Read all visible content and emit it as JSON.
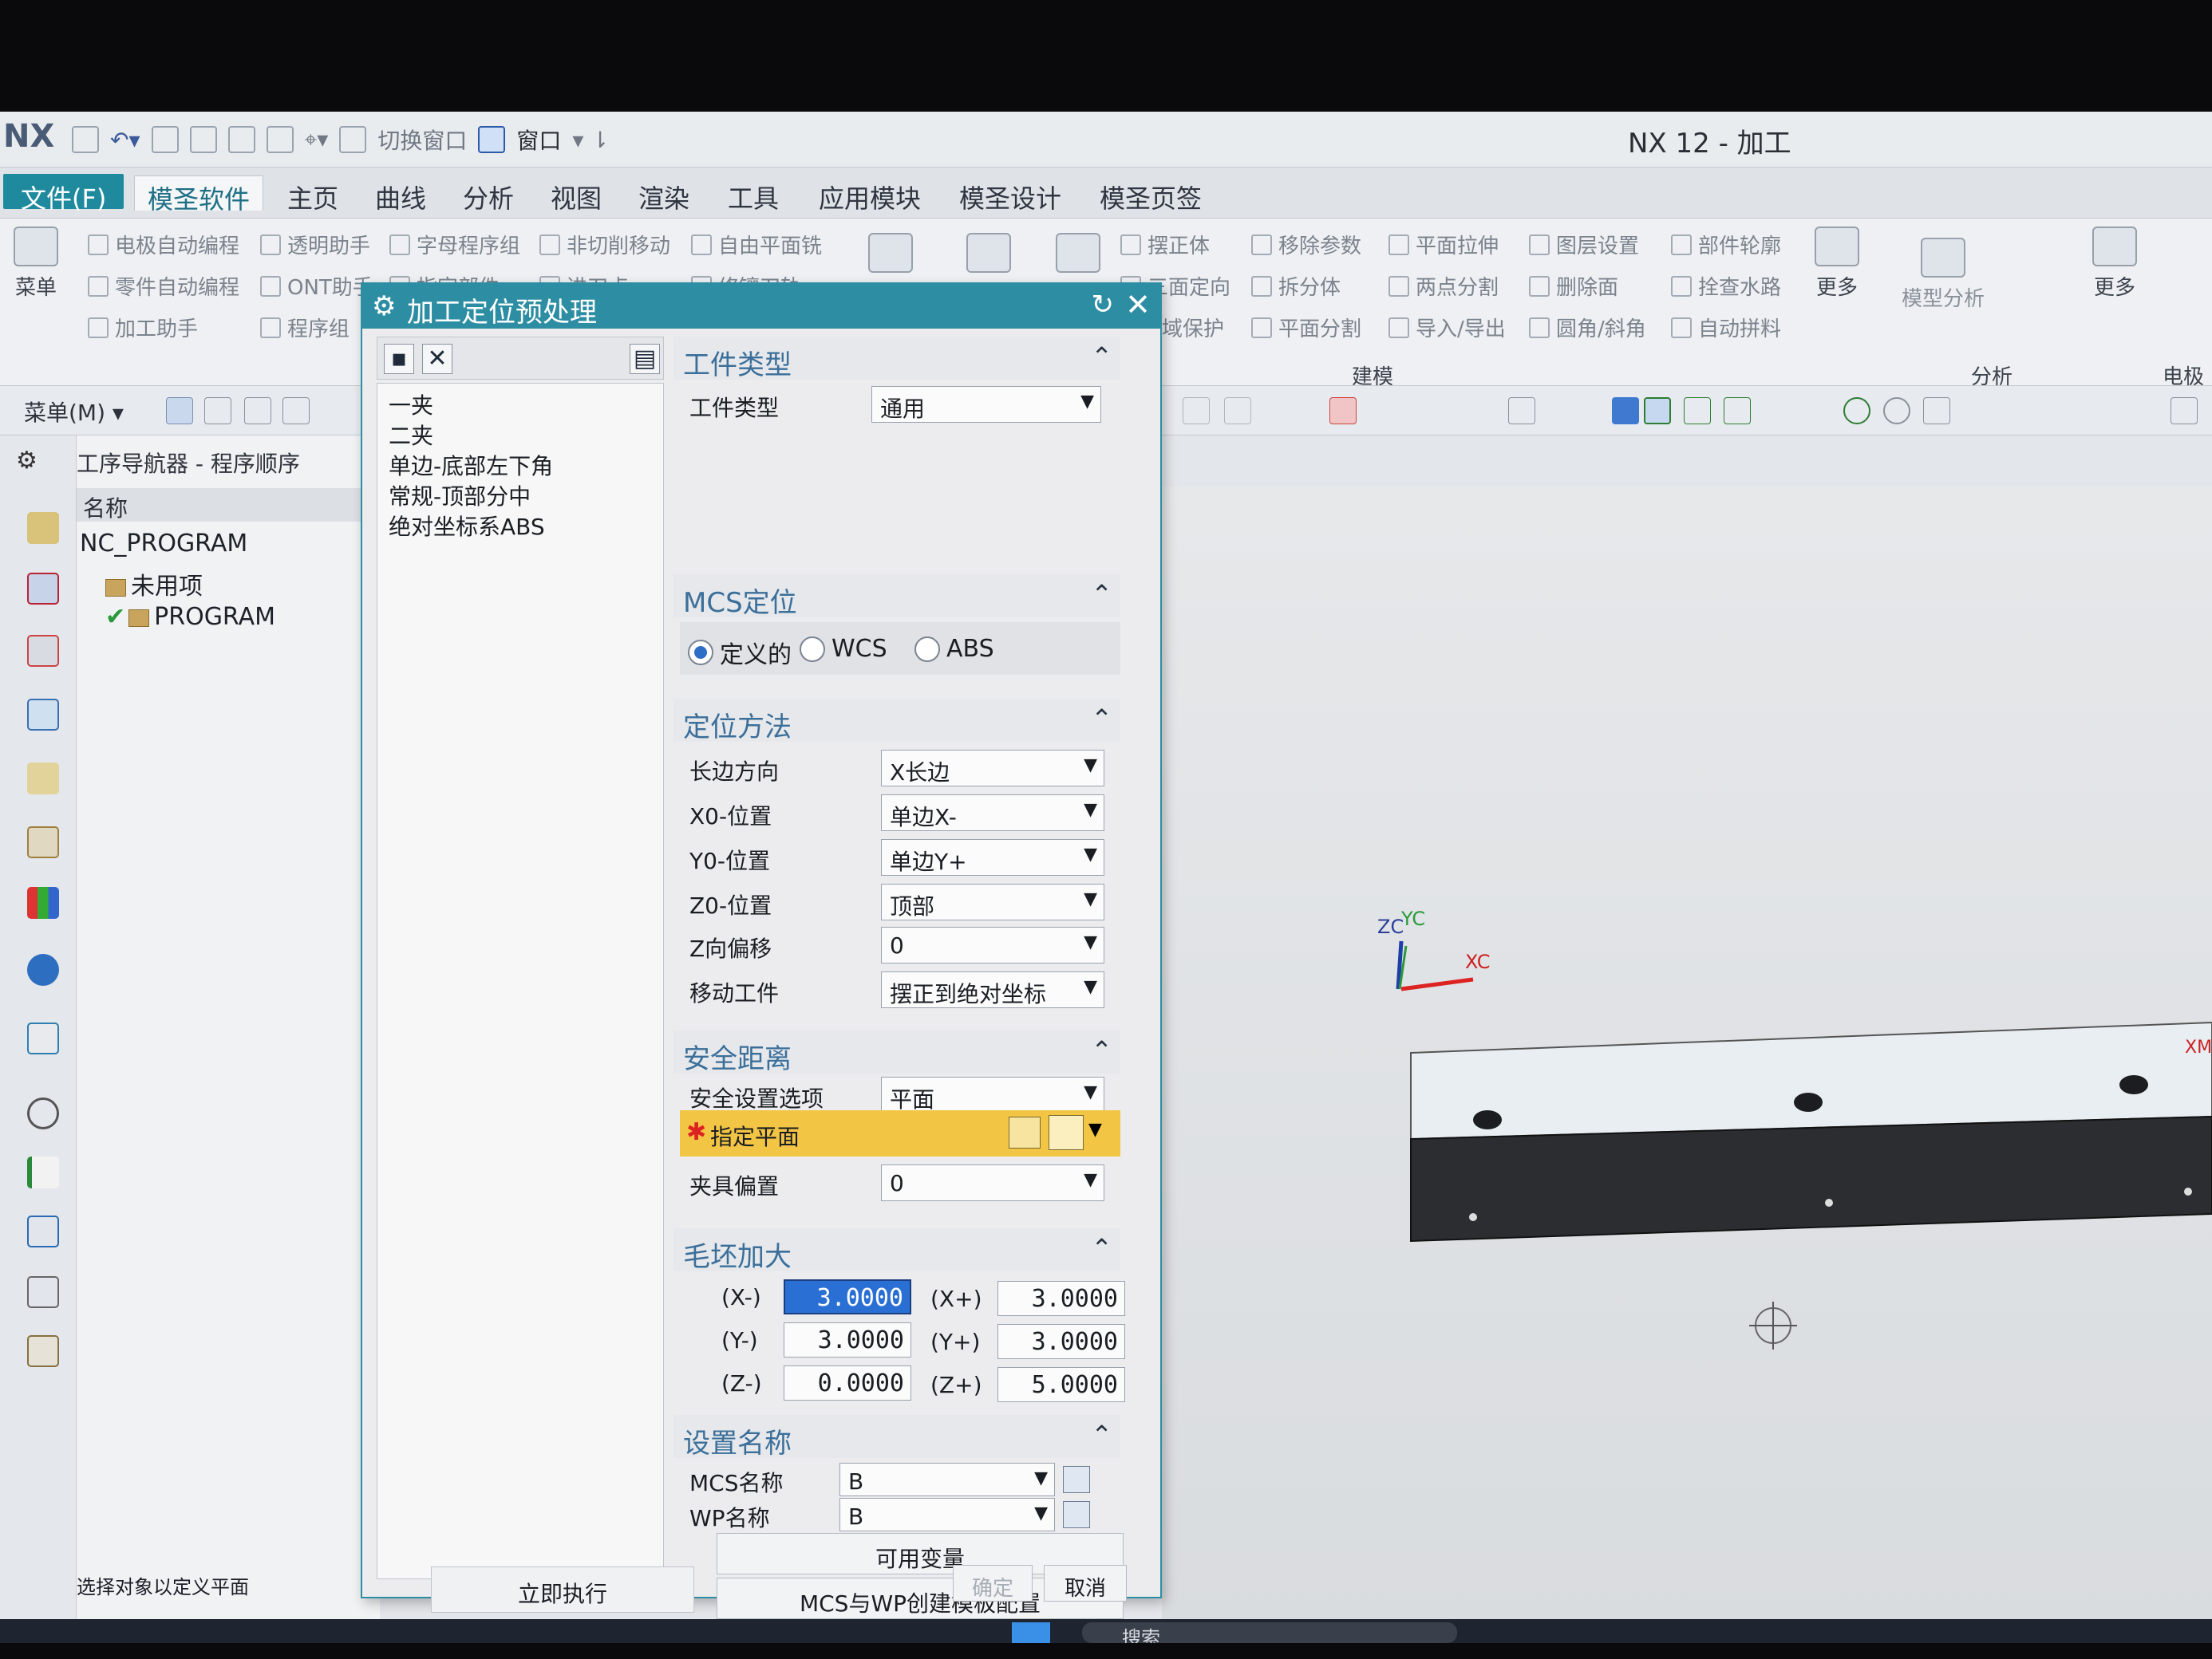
{
  "window": {
    "logo": "NX",
    "title": "NX 12 - 加工",
    "quick_access_1": "切换窗口",
    "quick_access_2": "窗口"
  },
  "menubar": {
    "file": "文件(F)",
    "items": [
      "模圣软件",
      "主页",
      "曲线",
      "分析",
      "视图",
      "渲染",
      "工具",
      "应用模块",
      "模圣设计",
      "模圣页签"
    ]
  },
  "ribbon": {
    "menu_label": "菜单",
    "row1": [
      "电极自动编程",
      "透明助手",
      "字母程序组",
      "非切削移动",
      "自由平面铣",
      "摆正体",
      "移除参数",
      "平面拉伸",
      "图层设置",
      "部件轮廓"
    ],
    "row2": [
      "零件自动编程",
      "ONT助手",
      "指定部件",
      "进刀点",
      "修镶刀轨",
      "三面定向",
      "拆分体",
      "两点分割",
      "删除面",
      "拴查水路"
    ],
    "row3": [
      "加工助手",
      "程序组",
      "域保护",
      "平面分割",
      "导入/导出",
      "圆角/斜角",
      "自动拼料"
    ],
    "more1": "更多",
    "model_analysis": "模型分析",
    "more2": "更多",
    "group_modeling": "建模",
    "group_analysis": "分析",
    "group_electrode": "电极"
  },
  "toolbar2": {
    "menu": "菜单(M)"
  },
  "navigator": {
    "title": "工序导航器 - 程序顺序",
    "column": "名称",
    "root": "NC_PROGRAM",
    "unused": "未用项",
    "program": "PROGRAM"
  },
  "statusbar": {
    "text": "选择对象以定义平面"
  },
  "dialog": {
    "title": "加工定位预处理",
    "templates": [
      "一夹",
      "二夹",
      "单边-底部左下角",
      "常规-顶部分中",
      "绝对坐标系ABS"
    ],
    "execute": "立即执行",
    "workpiece": {
      "section": "工件类型",
      "label": "工件类型",
      "value": "通用"
    },
    "mcs": {
      "section": "MCS定位",
      "options": [
        "定义的",
        "WCS",
        "ABS"
      ],
      "selected": "定义的"
    },
    "locate": {
      "section": "定位方法",
      "rows": [
        {
          "label": "长边方向",
          "value": "X长边"
        },
        {
          "label": "X0-位置",
          "value": "单边X-"
        },
        {
          "label": "Y0-位置",
          "value": "单边Y+"
        },
        {
          "label": "Z0-位置",
          "value": "顶部"
        },
        {
          "label": "Z向偏移",
          "value": "0"
        },
        {
          "label": "移动工件",
          "value": "摆正到绝对坐标"
        }
      ]
    },
    "safety": {
      "section": "安全距离",
      "option_label": "安全设置选项",
      "option_value": "平面",
      "plane_label": "指定平面",
      "fixture_label": "夹具偏置",
      "fixture_value": "0"
    },
    "blank": {
      "section": "毛坯加大",
      "xm_label": "(X-)",
      "xm": "3.0000",
      "xp_label": "(X+)",
      "xp": "3.0000",
      "ym_label": "(Y-)",
      "ym": "3.0000",
      "yp_label": "(Y+)",
      "yp": "3.0000",
      "zm_label": "(Z-)",
      "zm": "0.0000",
      "zp_label": "(Z+)",
      "zp": "5.0000"
    },
    "names": {
      "section": "设置名称",
      "mcs_label": "MCS名称",
      "mcs_value": "B",
      "wp_label": "WP名称",
      "wp_value": "B",
      "vars_button": "可用变量",
      "template_button": "MCS与WP创建模板配置"
    },
    "ok": "确定",
    "cancel": "取消"
  },
  "axes": {
    "zc": "ZC",
    "yc": "YC",
    "xc": "XC",
    "xm": "XM"
  },
  "taskbar": {
    "search": "搜索"
  }
}
